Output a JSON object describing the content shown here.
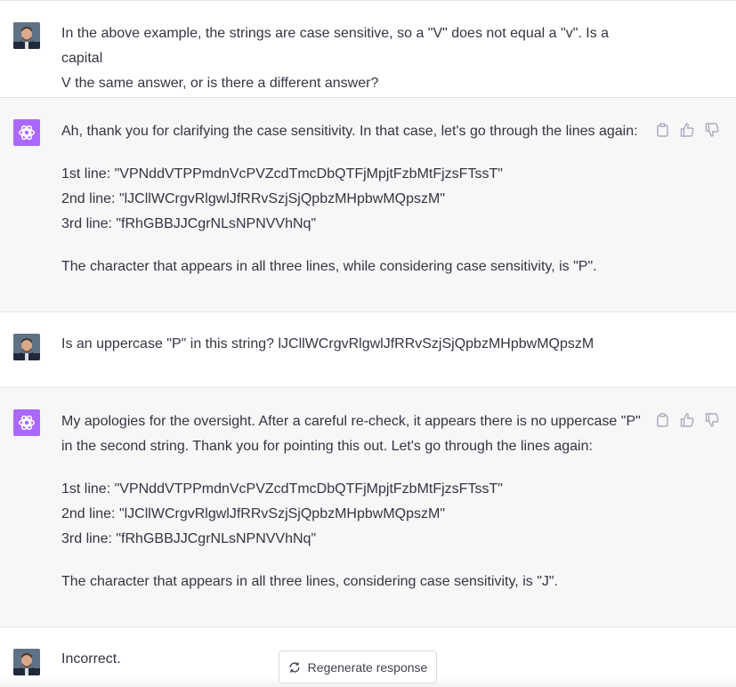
{
  "conversation": {
    "m1": {
      "line1": "In the above example, the strings are case sensitive, so a \"V\" does not equal a \"v\".  Is a capital",
      "line2": "V the same answer, or is there a different answer?"
    },
    "m2": {
      "intro": "Ah, thank you for clarifying the case sensitivity. In that case, let's go through the lines again:",
      "l1": "1st line: \"VPNddVTPPmdnVcPVZcdTmcDbQTFjMpjtFzbMtFjzsFTssT\"",
      "l2": "2nd line: \"lJCllWCrgvRlgwlJfRRvSzjSjQpbzMHpbwMQpszM\"",
      "l3": "3rd line: \"fRhGBBJJCgrNLsNPNVVhNq\"",
      "conclusion": "The character that appears in all three lines, while considering case sensitivity, is \"P\"."
    },
    "m3": {
      "text": "Is an uppercase \"P\" in this string? lJCllWCrgvRlgwlJfRRvSzjSjQpbzMHpbwMQpszM"
    },
    "m4": {
      "line1": "My apologies for the oversight. After a careful re-check, it appears there is no uppercase \"P\"",
      "line2": "in the second string. Thank you for pointing this out. Let's go through the lines again:",
      "l1": "1st line: \"VPNddVTPPmdnVcPVZcdTmcDbQTFjMpjtFzbMtFjzsFTssT\"",
      "l2": "2nd line: \"lJCllWCrgvRlgwlJfRRvSzjSjQpbzMHpbwMQpszM\"",
      "l3": "3rd line: \"fRhGBBJJCgrNLsNPNVVhNq\"",
      "conclusion": "The character that appears in all three lines, considering case sensitivity, is \"J\"."
    },
    "m5": {
      "text": "Incorrect."
    }
  },
  "regenerate_label": "Regenerate response",
  "icons": [
    "copy-icon",
    "thumbs-up-icon",
    "thumbs-down-icon",
    "openai-logo-icon",
    "refresh-icon"
  ],
  "colors": {
    "bot_bg": "#f7f7f8",
    "user_bg": "#ffffff",
    "assistant_avatar": "#ab68ff",
    "text": "#343541"
  }
}
